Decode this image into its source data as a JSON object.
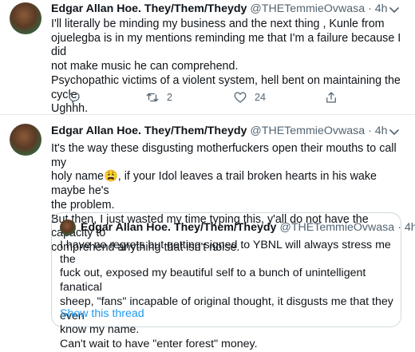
{
  "tweets": [
    {
      "author_name": "Edgar Allan Hoe. They/Them/Theydy",
      "handle": "@THETemmieOvwasa",
      "separator": "·",
      "time": "4h",
      "lines": [
        "I'll literally be minding my business and the next thing , Kunle from",
        "ojuelegba is in my mentions reminding me that I'm a failure because I did",
        "not make music he can comprehend.",
        "Psychopathic victims of a violent system, hell bent on maintaining the cycle.",
        "Ughhh."
      ],
      "retweet_count": "2",
      "like_count": "24",
      "icons": [
        "reply-icon",
        "retweet-icon",
        "like-icon",
        "share-icon"
      ]
    },
    {
      "author_name": "Edgar Allan Hoe. They/Them/Theydy",
      "handle": "@THETemmieOvwasa",
      "separator": "·",
      "time": "4h",
      "lines": [
        "It's the way these disgusting motherfuckers open their mouths to call my",
        "holy name😩, if your Idol leaves a trail broken hearts in his wake maybe he's",
        "the problem.",
        "But then, I just wasted my time typing this, y'all do not have the capacity to",
        "comprehend anything that isn't noise."
      ],
      "quote": {
        "author_name": "Edgar Allan Hoe. They/Them/Theydy",
        "handle": "@THETemmieOvwasa",
        "separator": "·",
        "time": "4h",
        "lines": [
          "I have no regrets but getting signed to YBNL will always stress me the",
          "fuck out, exposed my beautiful self to a bunch of unintelligent fanatical",
          "sheep, \"fans\" incapable of original thought, it disgusts me that they even",
          "know my name.",
          "Can't wait to have \"enter forest\" money."
        ],
        "show_thread": "Show this thread"
      }
    }
  ],
  "colors": {
    "text": "#0f1419",
    "secondary": "#536471",
    "link": "#1d9bf0",
    "border": "#e1e8ed"
  }
}
